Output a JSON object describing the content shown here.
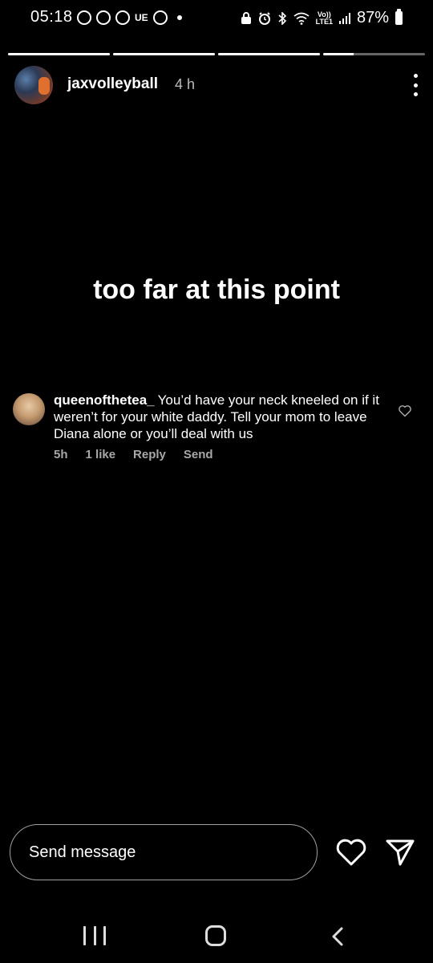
{
  "status_bar": {
    "time": "05:18",
    "left_icons": [
      "whatsapp-icon",
      "circle-app-icon",
      "pinterest-icon",
      "ue-icon",
      "news-icon"
    ],
    "ue_label": "UE",
    "right_icons": [
      "alarm-lock-icon",
      "alarm-clock-icon",
      "bluetooth-icon",
      "wifi-icon",
      "volte-icon",
      "signal-icon"
    ],
    "volte_label": "Vo))\nLTE1",
    "battery_percent": "87%"
  },
  "story": {
    "segments": [
      1.0,
      1.0,
      1.0,
      0.3
    ],
    "username": "jaxvolleyball",
    "time_ago": "4 h",
    "text": "too far at this point"
  },
  "comment": {
    "username": "queenofthetea_",
    "text": "You’d have your neck kneeled on if it weren’t for your white daddy. Tell your mom to leave Diana alone or you’ll deal with us",
    "time": "5h",
    "likes": "1 like",
    "reply_label": "Reply",
    "send_label": "Send"
  },
  "composer": {
    "placeholder": "Send message"
  }
}
